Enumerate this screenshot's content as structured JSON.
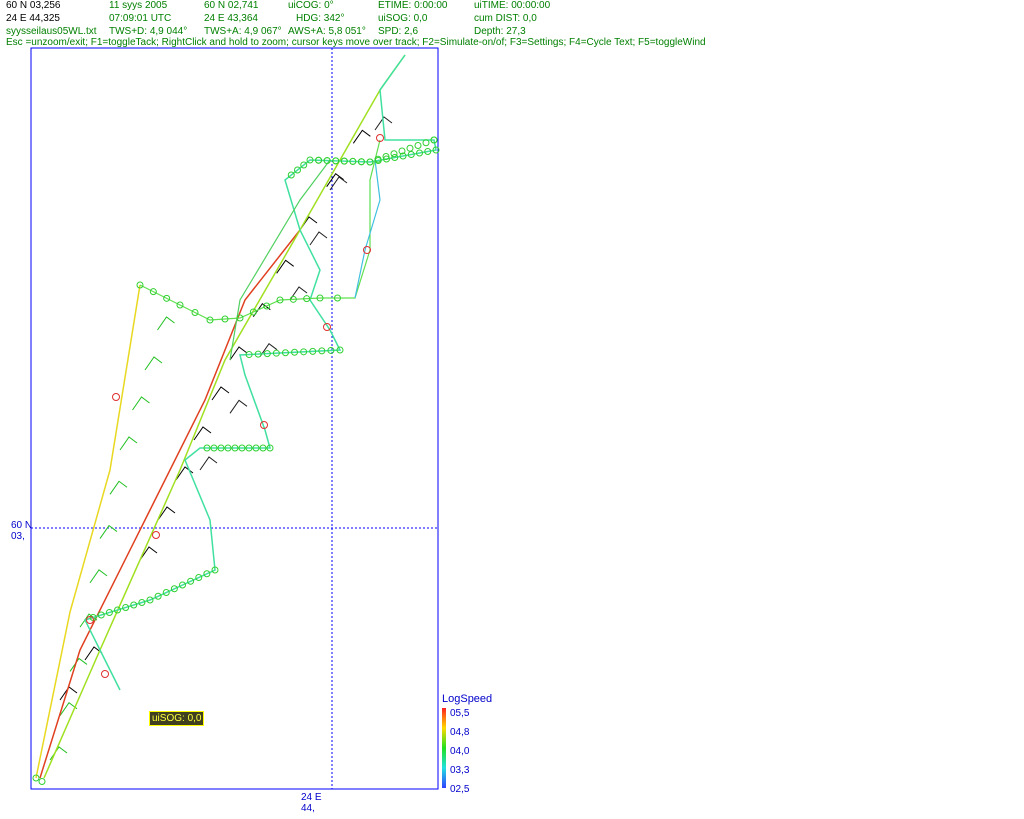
{
  "header": {
    "lat": "60 N 03,256",
    "lon": "24 E 44,325",
    "file": "syysseilaus05WL.txt",
    "date": "11 syys 2005",
    "time": "07:09:01  UTC",
    "tws_d": "TWS+D: 4,9 044°",
    "lat2": "60 N 02,741",
    "lon2": "24 E 43,364",
    "tws_a": "TWS+A: 4,9 067°",
    "uicog": "uiCOG: 0°",
    "hdg": "HDG: 342°",
    "aws_a": "AWS+A: 5,8 051°",
    "etime": "ETIME: 0:00:00",
    "uisog": "uiSOG: 0,0",
    "spd": "SPD: 2,6",
    "uitime": "uiTIME: 00:00:00",
    "cumdist": "cum DIST: 0,0",
    "depth": "Depth: 27,3",
    "help": "Esc =unzoom/exit; F1=toggleTack; RightClick and hold to zoom; cursor keys move over track; F2=Simulate-on/of; F3=Settings; F4=Cycle Text; F5=toggleWind"
  },
  "map": {
    "lat_label_1": "60 N",
    "lat_label_2": "03,",
    "lon_label_1": "24 E",
    "lon_label_2": "44,"
  },
  "legend": {
    "title": "LogSpeed",
    "values": [
      "05,5",
      "04,8",
      "04,0",
      "03,3",
      "02,5"
    ]
  },
  "overlay": {
    "sog_label": "uiSOG: 0,0"
  },
  "colors": {
    "frame": "#0000ff",
    "crosshair": "#0000ff",
    "header_text": "#008000"
  }
}
